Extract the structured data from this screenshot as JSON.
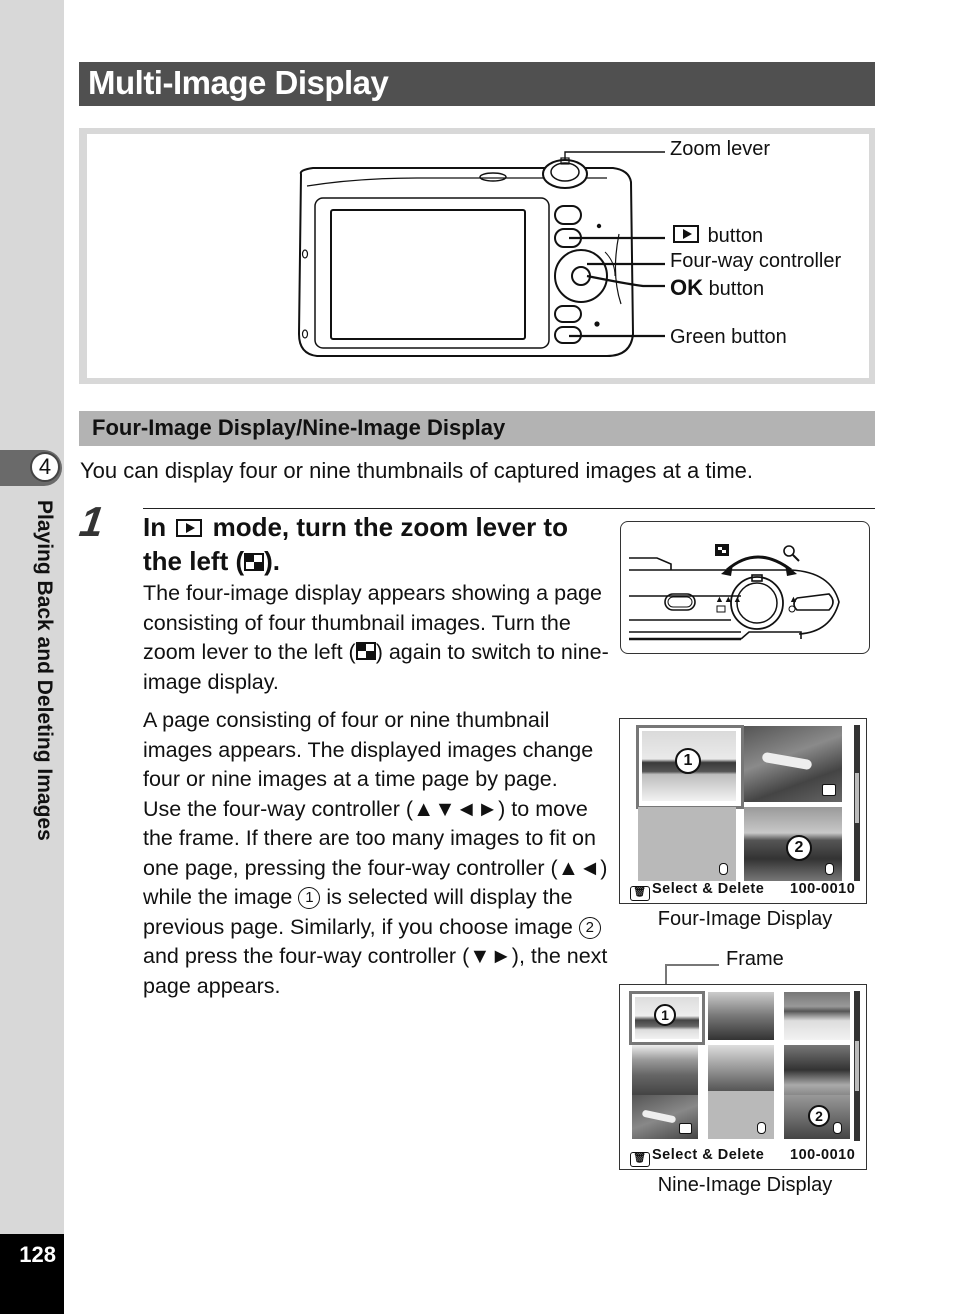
{
  "sidebar": {
    "chapter_number": "4",
    "chapter_title": "Playing Back and Deleting Images",
    "page_number": "128"
  },
  "header": {
    "title": "Multi-Image Display"
  },
  "camera_figure": {
    "callouts": {
      "zoom_lever": "Zoom lever",
      "playback_button": "button",
      "four_way_controller": "Four-way controller",
      "ok_label": "OK",
      "ok_button": "button",
      "green_button": "Green button"
    }
  },
  "section": {
    "title": "Four-Image Display/Nine-Image Display",
    "intro": "You can display four or nine thumbnails of captured images at a time."
  },
  "step": {
    "number": "1",
    "heading_part1": "In",
    "heading_part2": "mode, turn the zoom lever to",
    "heading_part3": "the left (",
    "heading_part4": ").",
    "para1_a": "The four-image display appears showing a page consisting of four thumbnail images. Turn the zoom lever to the left (",
    "para1_b": ") again to switch to nine-image display.",
    "para2_a": "A page consisting of four or nine thumbnail images appears. The displayed images change four or nine images at a time page by page.",
    "para2_b": "Use the four-way controller (▲▼◄►) to move the frame. If there are too many images to fit on one page, pressing the four-way controller (▲◄) while the image",
    "circle1": "1",
    "para2_c": "is selected will display the previous page. Similarly, if you choose image",
    "circle2": "2",
    "para2_d": "and press the four-way controller (▼►), the next page appears."
  },
  "four_image_display": {
    "caption": "Four-Image Display",
    "badge_1": "1",
    "badge_2": "2",
    "select_delete": "Select & Delete",
    "file_number": "100-0010"
  },
  "nine_image_display": {
    "caption": "Nine-Image Display",
    "frame_label": "Frame",
    "badge_1": "1",
    "badge_2": "2",
    "select_delete": "Select & Delete",
    "file_number": "100-0010"
  },
  "colors": {
    "title_bar": "#505050",
    "subheading_bar": "#b3b3b3",
    "sidebar": "#d8d8d8",
    "page_number_box": "#000000"
  }
}
